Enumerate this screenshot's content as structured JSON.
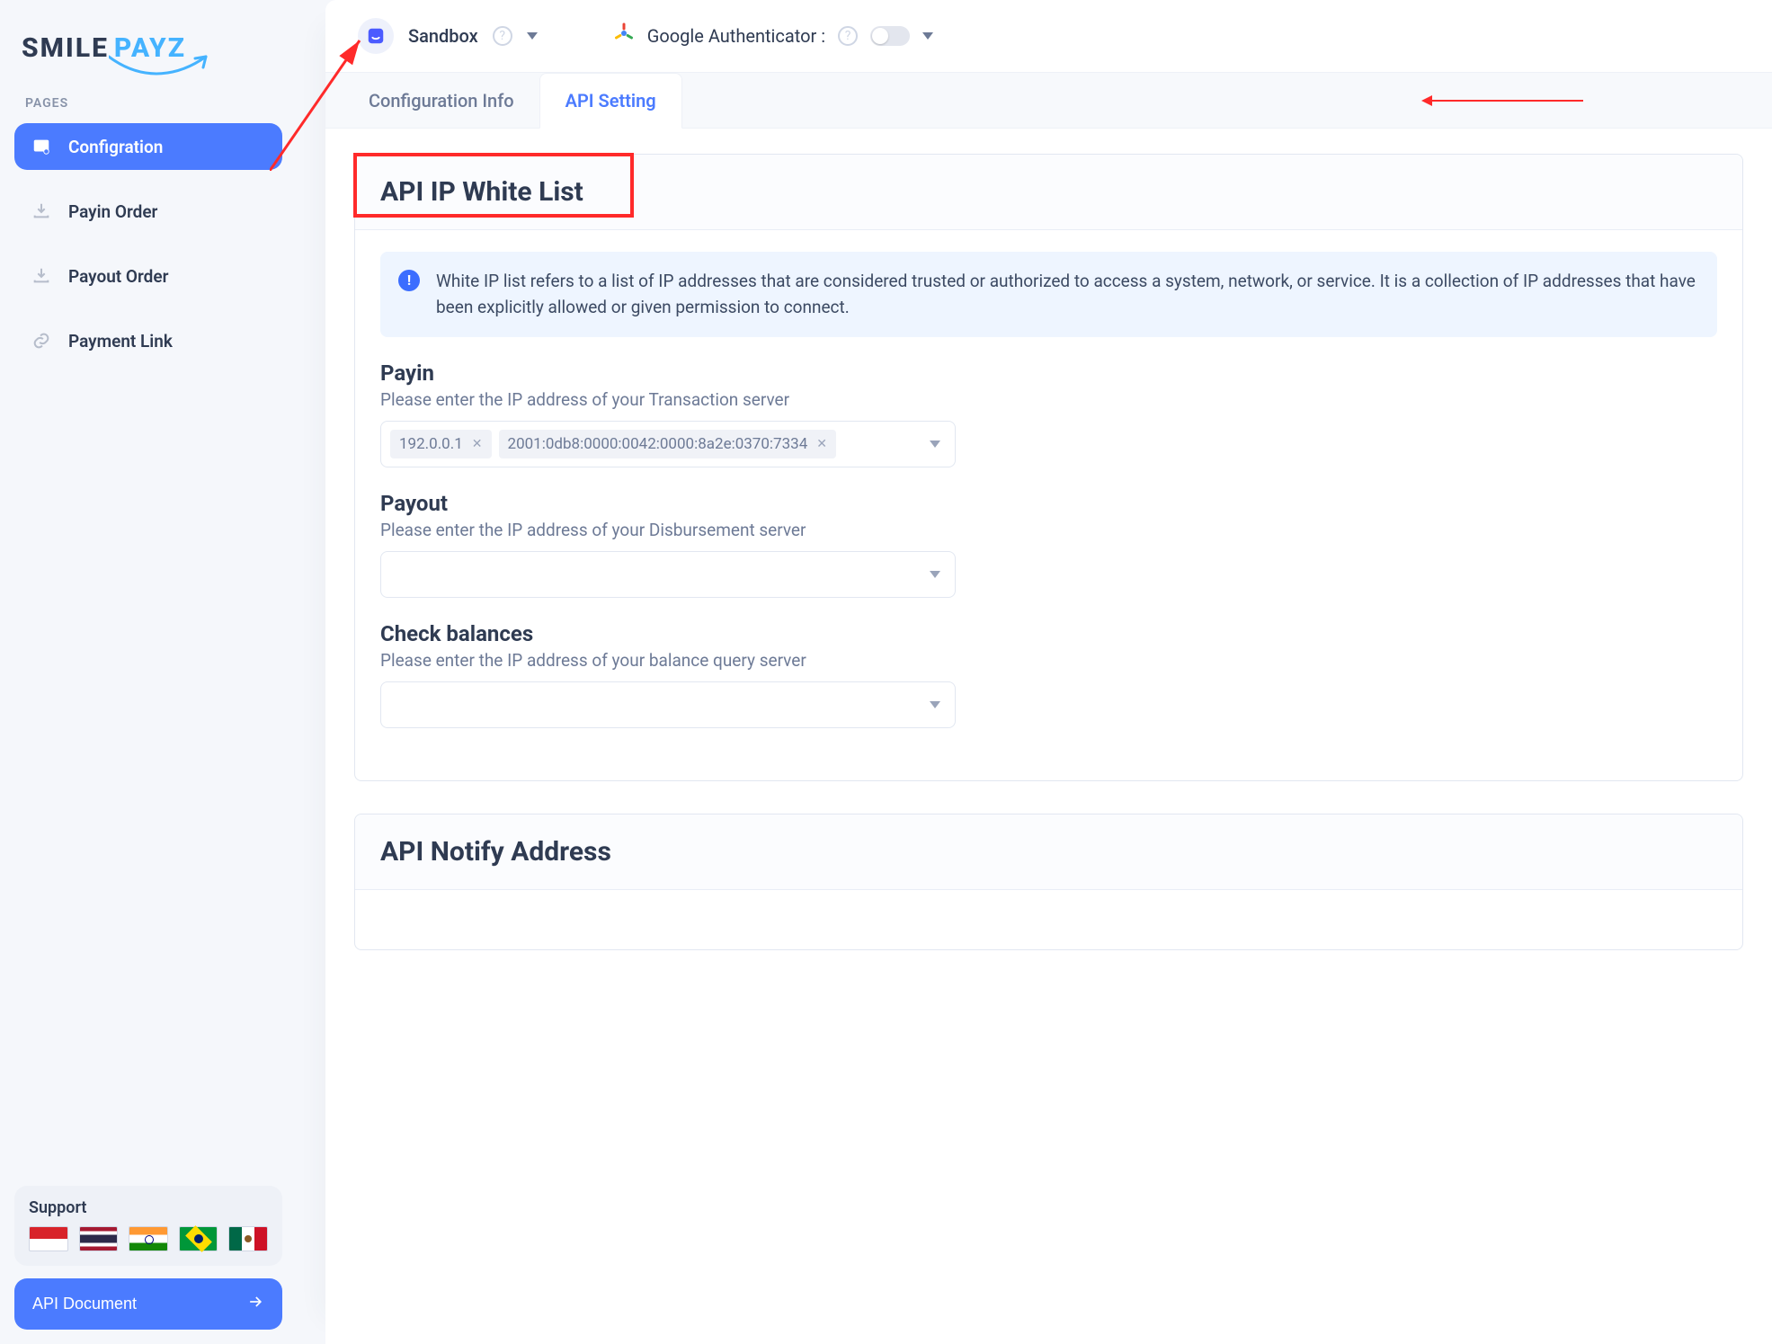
{
  "brand": {
    "part1": "SMILE",
    "part2": "PAYZ"
  },
  "sidebar": {
    "section": "PAGES",
    "items": [
      {
        "label": "Configration"
      },
      {
        "label": "Payin Order"
      },
      {
        "label": "Payout Order"
      },
      {
        "label": "Payment Link"
      }
    ]
  },
  "support": {
    "title": "Support",
    "doc_button": "API Document"
  },
  "topbar": {
    "env": "Sandbox",
    "ga_label": "Google Authenticator :"
  },
  "tabs": {
    "config": "Configuration Info",
    "api": "API Setting"
  },
  "whitelist": {
    "title": "API IP White List",
    "alert": "White IP list refers to a list of IP addresses that are considered trusted or authorized to access a system, network, or service. It is a collection of IP addresses that have been explicitly allowed or given permission to connect.",
    "payin": {
      "label": "Payin",
      "help": "Please enter the IP address of your Transaction server",
      "tags": [
        "192.0.0.1",
        "2001:0db8:0000:0042:0000:8a2e:0370:7334"
      ]
    },
    "payout": {
      "label": "Payout",
      "help": "Please enter the IP address of your Disbursement server"
    },
    "balance": {
      "label": "Check balances",
      "help": "Please enter the IP address of your balance query server"
    }
  },
  "notify": {
    "title": "API Notify Address"
  }
}
